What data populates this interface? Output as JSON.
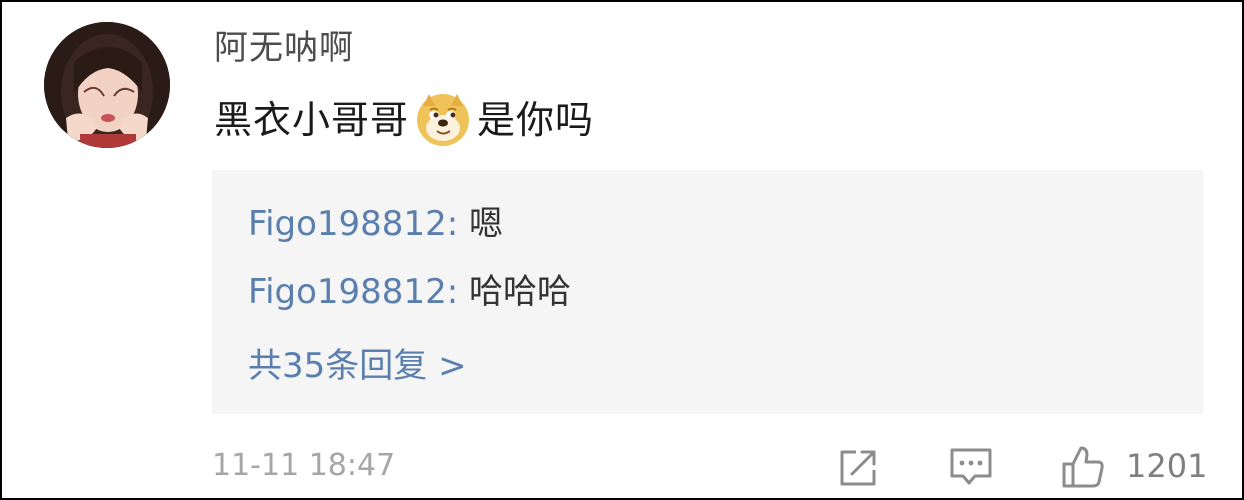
{
  "comment": {
    "username": "阿无呐啊",
    "text_before": "黑衣小哥哥",
    "emoji": "doge-emoji",
    "text_after": "是你吗"
  },
  "replies": {
    "items": [
      {
        "author": "Figo198812",
        "separator": ":",
        "text": "嗯"
      },
      {
        "author": "Figo198812",
        "separator": ":",
        "text": "哈哈哈"
      }
    ],
    "more_label": "共35条回复 >"
  },
  "footer": {
    "timestamp": "11-11 18:47",
    "share_icon": "share-icon",
    "comment_icon": "comment-icon",
    "like_icon": "thumbs-up-icon",
    "like_count": "1201"
  },
  "colors": {
    "link": "#5a7fae",
    "reply_bg": "#f5f5f5",
    "meta": "#a6a6a6"
  }
}
